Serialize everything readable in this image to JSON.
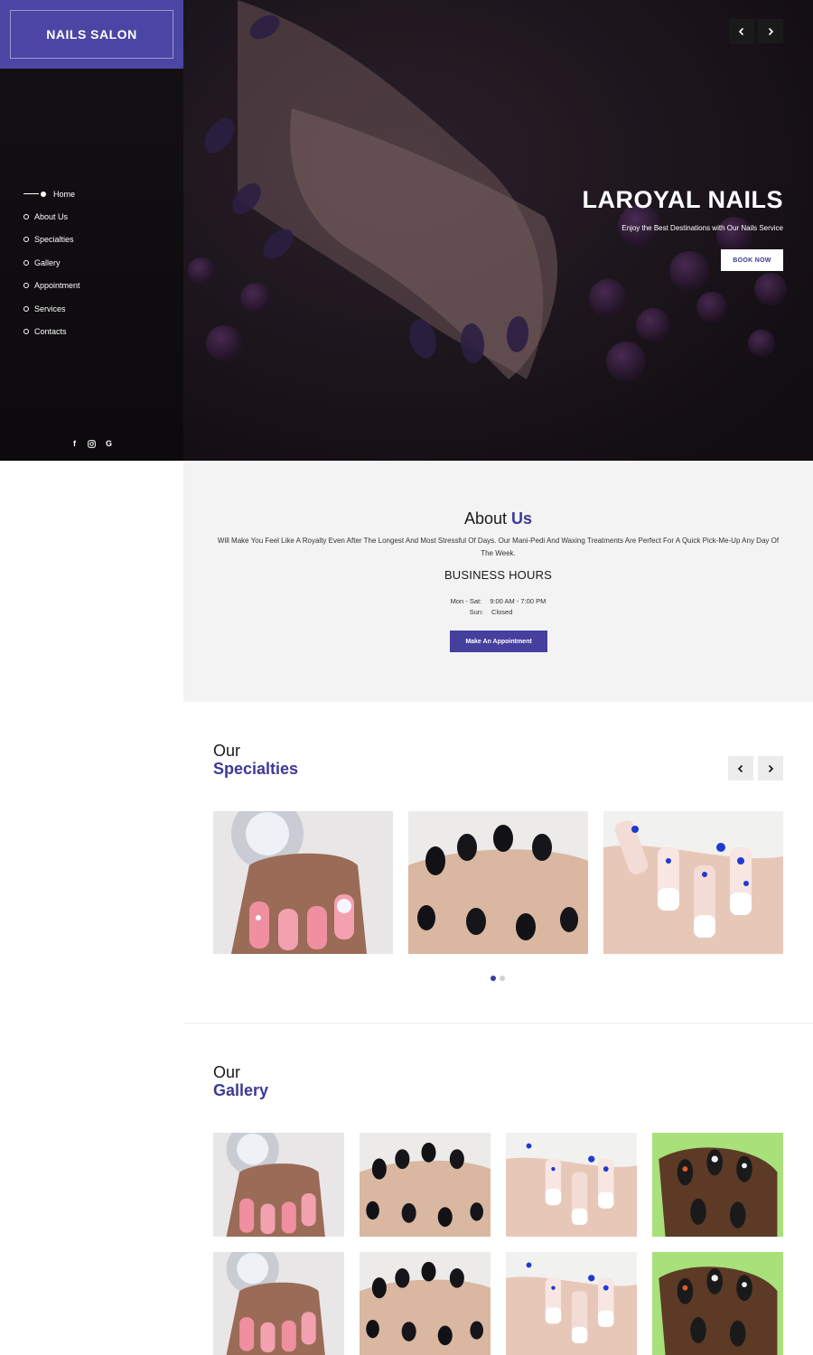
{
  "brand": {
    "name": "NAILS SALON",
    "color": "#4b46a3"
  },
  "nav": {
    "items": [
      {
        "label": "Home",
        "active": true
      },
      {
        "label": "About Us",
        "active": false
      },
      {
        "label": "Specialties",
        "active": false
      },
      {
        "label": "Gallery",
        "active": false
      },
      {
        "label": "Appointment",
        "active": false
      },
      {
        "label": "Services",
        "active": false
      },
      {
        "label": "Contacts",
        "active": false
      }
    ]
  },
  "social": {
    "icons": [
      "facebook-icon",
      "instagram-icon",
      "google-icon"
    ],
    "facebook": "f",
    "google": "G"
  },
  "hero": {
    "title": "LAROYAL NAILS",
    "subtitle": "Enjoy the Best Destinations with Our Nails Service",
    "button": "BOOK NOW"
  },
  "about": {
    "heading_plain": "About",
    "heading_accent": "Us",
    "description": "Will Make You Feel Like A Royalty Even After The Longest And Most Stressful Of Days. Our Mani-Pedi And Waxing Treatments Are Perfect For A Quick Pick-Me-Up Any Day Of The Week.",
    "business_hours_title": "BUSINESS HOURS",
    "hours": [
      {
        "days": "Mon - Sat:",
        "time": "9:00 AM - 7:00 PM"
      },
      {
        "days": "Sun:",
        "time": "Closed"
      }
    ],
    "button": "Make An Appointment"
  },
  "specialties": {
    "heading_plain": "Our",
    "heading_accent": "Specialties",
    "page_count": 2,
    "active_page": 1
  },
  "gallery": {
    "heading_plain": "Our",
    "heading_accent": "Gallery"
  },
  "colors": {
    "accent": "#3d3a95",
    "button": "#453f9e",
    "about_bg": "#f3f3f4"
  }
}
